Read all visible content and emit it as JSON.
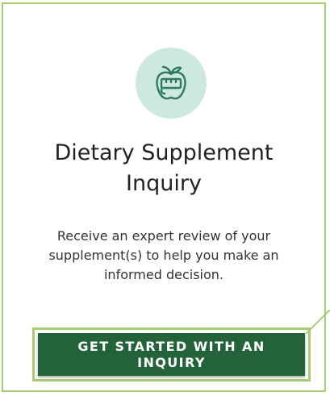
{
  "card": {
    "icon": "apple-measuring-tape-icon",
    "title": "Dietary Supplement Inquiry",
    "description": "Receive an expert review of your supplement(s) to help you make an informed decision.",
    "button_label": "GET STARTED WITH AN INQUIRY"
  },
  "colors": {
    "border_accent": "#a7cc73",
    "icon_bg": "#cde8e1",
    "icon_stroke": "#2f7a5f",
    "button_bg": "#24633a",
    "button_text": "#ffffff"
  }
}
